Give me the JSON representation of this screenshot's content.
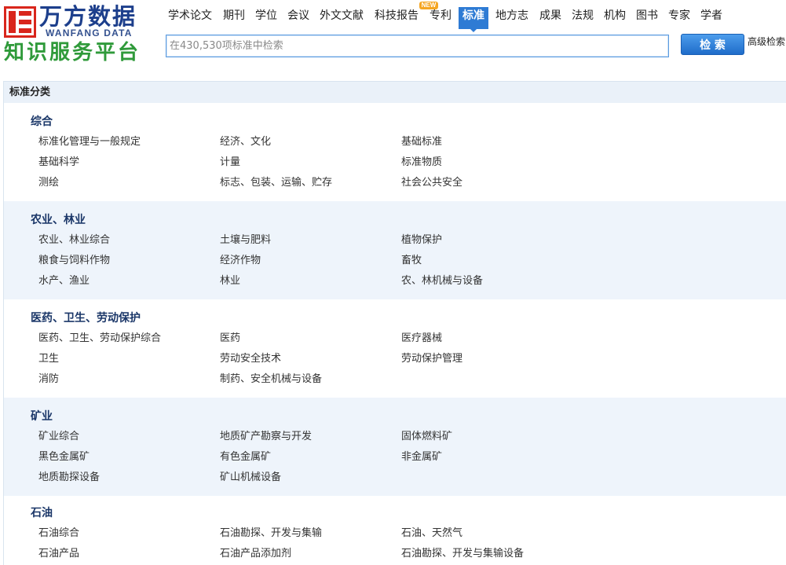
{
  "theme": {
    "accent": "#2e7bd4",
    "logo_red": "#d9261c",
    "logo_blue": "#1d3f8c",
    "logo_green": "#2f9a3a",
    "badge": "#f5a623"
  },
  "logo": {
    "icon": "wanfang-logo-mark",
    "name_cn": "万方数据",
    "name_en": "WANFANG DATA",
    "tagline": "知识服务平台"
  },
  "nav": {
    "items": [
      {
        "label": "学术论文"
      },
      {
        "label": "期刊"
      },
      {
        "label": "学位"
      },
      {
        "label": "会议"
      },
      {
        "label": "外文文献"
      },
      {
        "label": "科技报告"
      },
      {
        "label": "专利",
        "badge": "NEW"
      },
      {
        "label": "标准",
        "active": true
      },
      {
        "label": "地方志"
      },
      {
        "label": "成果"
      },
      {
        "label": "法规"
      },
      {
        "label": "机构"
      },
      {
        "label": "图书"
      },
      {
        "label": "专家"
      },
      {
        "label": "学者"
      }
    ]
  },
  "search": {
    "placeholder": "在430,530项标准中检索",
    "value": "",
    "button_label": "检 索",
    "advanced_label": "高级检索"
  },
  "classification": {
    "header": "标准分类",
    "categories": [
      {
        "title": "综合",
        "items": [
          "标准化管理与一般规定",
          "经济、文化",
          "基础标准",
          "基础科学",
          "计量",
          "标准物质",
          "测绘",
          "标志、包装、运输、贮存",
          "社会公共安全"
        ]
      },
      {
        "title": "农业、林业",
        "items": [
          "农业、林业综合",
          "土壤与肥料",
          "植物保护",
          "粮食与饲料作物",
          "经济作物",
          "畜牧",
          "水产、渔业",
          "林业",
          "农、林机械与设备"
        ]
      },
      {
        "title": "医药、卫生、劳动保护",
        "items": [
          "医药、卫生、劳动保护综合",
          "医药",
          "医疗器械",
          "卫生",
          "劳动安全技术",
          "劳动保护管理",
          "消防",
          "制药、安全机械与设备"
        ]
      },
      {
        "title": "矿业",
        "items": [
          "矿业综合",
          "地质矿产勘察与开发",
          "固体燃料矿",
          "黑色金属矿",
          "有色金属矿",
          "非金属矿",
          "地质勘探设备",
          "矿山机械设备"
        ]
      },
      {
        "title": "石油",
        "items": [
          "石油综合",
          "石油勘探、开发与集输",
          "石油、天然气",
          "石油产品",
          "石油产品添加剂",
          "石油勘探、开发与集输设备"
        ]
      }
    ]
  }
}
